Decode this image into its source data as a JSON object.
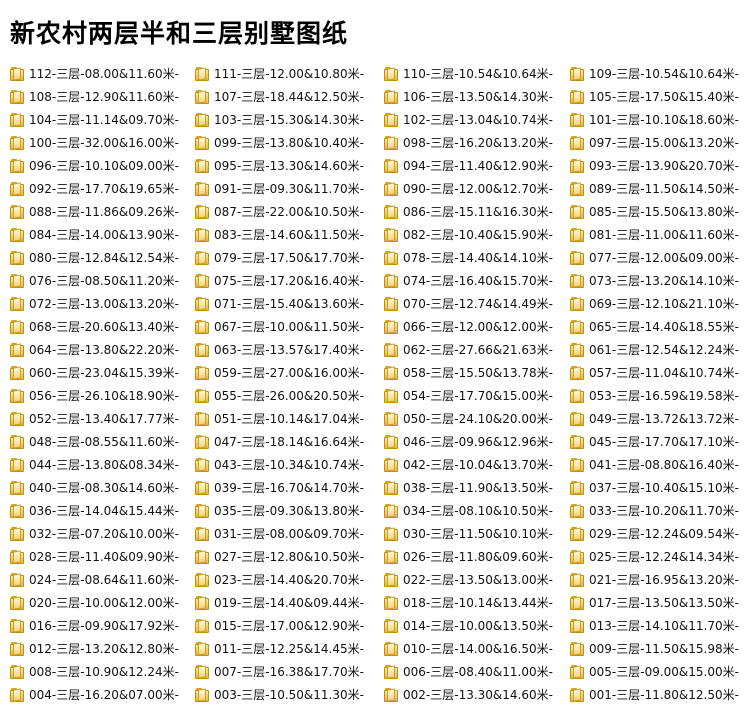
{
  "title": "新农村两层半和三层别墅图纸",
  "folder_icon": "folder-icon",
  "items": [
    "112-三层-08.00&11.60米-",
    "111-三层-12.00&10.80米-",
    "110-三层-10.54&10.64米-",
    "109-三层-10.54&10.64米-",
    "108-三层-12.90&11.60米-",
    "107-三层-18.44&12.50米-",
    "106-三层-13.50&14.30米-",
    "105-三层-17.50&15.40米-",
    "104-三层-11.14&09.70米-",
    "103-三层-15.30&14.30米-",
    "102-三层-13.04&10.74米-",
    "101-三层-10.10&18.60米-",
    "100-三层-32.00&16.00米-",
    "099-三层-13.80&10.40米-",
    "098-三层-16.20&13.20米-",
    "097-三层-15.00&13.20米-",
    "096-三层-10.10&09.00米-",
    "095-三层-13.30&14.60米-",
    "094-三层-11.40&12.90米-",
    "093-三层-13.90&20.70米-",
    "092-三层-17.70&19.65米-",
    "091-三层-09.30&11.70米-",
    "090-三层-12.00&12.70米-",
    "089-三层-11.50&14.50米-",
    "088-三层-11.86&09.26米-",
    "087-三层-22.00&10.50米-",
    "086-三层-15.11&16.30米-",
    "085-三层-15.50&13.80米-",
    "084-三层-14.00&13.90米-",
    "083-三层-14.60&11.50米-",
    "082-三层-10.40&15.90米-",
    "081-三层-11.00&11.60米-",
    "080-三层-12.84&12.54米-",
    "079-三层-17.50&17.70米-",
    "078-三层-14.40&14.10米-",
    "077-三层-12.00&09.00米-",
    "076-三层-08.50&11.20米-",
    "075-三层-17.20&16.40米-",
    "074-三层-16.40&15.70米-",
    "073-三层-13.20&14.10米-",
    "072-三层-13.00&13.20米-",
    "071-三层-15.40&13.60米-",
    "070-三层-12.74&14.49米-",
    "069-三层-12.10&21.10米-",
    "068-三层-20.60&13.40米-",
    "067-三层-10.00&11.50米-",
    "066-三层-12.00&12.00米-",
    "065-三层-14.40&18.55米-",
    "064-三层-13.80&22.20米-",
    "063-三层-13.57&17.40米-",
    "062-三层-27.66&21.63米-",
    "061-三层-12.54&12.24米-",
    "060-三层-23.04&15.39米-",
    "059-三层-27.00&16.00米-",
    "058-三层-15.50&13.78米-",
    "057-三层-11.04&10.74米-",
    "056-三层-26.10&18.90米-",
    "055-三层-26.00&20.50米-",
    "054-三层-17.70&15.00米-",
    "053-三层-16.59&19.58米-",
    "052-三层-13.40&17.77米-",
    "051-三层-10.14&17.04米-",
    "050-三层-24.10&20.00米-",
    "049-三层-13.72&13.72米-",
    "048-三层-08.55&11.60米-",
    "047-三层-18.14&16.64米-",
    "046-三层-09.96&12.96米-",
    "045-三层-17.70&17.10米-",
    "044-三层-13.80&08.34米-",
    "043-三层-10.34&10.74米-",
    "042-三层-10.04&13.70米-",
    "041-三层-08.80&16.40米-",
    "040-三层-08.30&14.60米-",
    "039-三层-16.70&14.70米-",
    "038-三层-11.90&13.50米-",
    "037-三层-10.40&15.10米-",
    "036-三层-14.04&15.44米-",
    "035-三层-09.30&13.80米-",
    "034-三层-08.10&10.50米-",
    "033-三层-10.20&11.70米-",
    "032-三层-07.20&10.00米-",
    "031-三层-08.00&09.70米-",
    "030-三层-11.50&10.10米-",
    "029-三层-12.24&09.54米-",
    "028-三层-11.40&09.90米-",
    "027-三层-12.80&10.50米-",
    "026-三层-11.80&09.60米-",
    "025-三层-12.24&14.34米-",
    "024-三层-08.64&11.60米-",
    "023-三层-14.40&20.70米-",
    "022-三层-13.50&13.00米-",
    "021-三层-16.95&13.20米-",
    "020-三层-10.00&12.00米-",
    "019-三层-14.40&09.44米-",
    "018-三层-10.14&13.44米-",
    "017-三层-13.50&13.50米-",
    "016-三层-09.90&17.92米-",
    "015-三层-17.00&12.90米-",
    "014-三层-10.00&13.50米-",
    "013-三层-14.10&11.70米-",
    "012-三层-13.20&12.80米-",
    "011-三层-12.25&14.45米-",
    "010-三层-14.00&16.50米-",
    "009-三层-11.50&15.98米-",
    "008-三层-10.90&12.24米-",
    "007-三层-16.38&17.70米-",
    "006-三层-08.40&11.00米-",
    "005-三层-09.00&15.00米-",
    "004-三层-16.20&07.00米-",
    "003-三层-10.50&11.30米-",
    "002-三层-13.30&14.60米-",
    "001-三层-11.80&12.50米-"
  ]
}
